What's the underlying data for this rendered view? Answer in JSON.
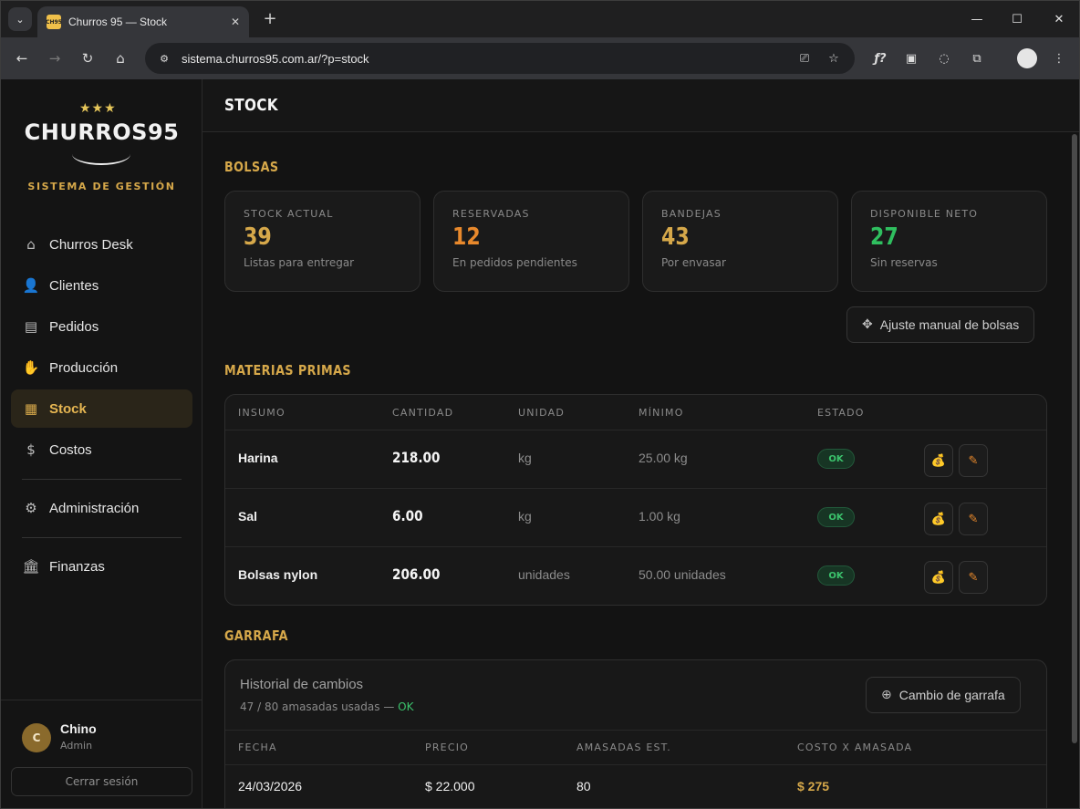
{
  "browser": {
    "tab_title": "Churros 95 — Stock",
    "tab_favicon_text": "CH95",
    "url": "sistema.churros95.com.ar/?p=stock"
  },
  "sidebar": {
    "logo_text": "CHURROS95",
    "logo_subtitle": "SISTEMA DE GESTIÓN",
    "items": [
      {
        "label": "Churros Desk",
        "icon": "home-icon"
      },
      {
        "label": "Clientes",
        "icon": "user-check-icon"
      },
      {
        "label": "Pedidos",
        "icon": "bag-icon"
      },
      {
        "label": "Producción",
        "icon": "hand-icon"
      },
      {
        "label": "Stock",
        "icon": "clipboard-icon",
        "active": true
      },
      {
        "label": "Costos",
        "icon": "dollar-circle-icon"
      },
      {
        "label": "Administración",
        "icon": "gear-icon"
      },
      {
        "label": "Finanzas",
        "icon": "bank-icon"
      }
    ],
    "user": {
      "initial": "C",
      "name": "Chino",
      "role": "Admin"
    },
    "logout_label": "Cerrar sesión"
  },
  "page": {
    "title": "STOCK",
    "bolsas": {
      "title": "BOLSAS",
      "cards": [
        {
          "label": "STOCK ACTUAL",
          "value": "39",
          "sub": "Listas para entregar",
          "color": "#d6a84a"
        },
        {
          "label": "RESERVADAS",
          "value": "12",
          "sub": "En pedidos pendientes",
          "color": "#e8892c"
        },
        {
          "label": "BANDEJAS",
          "value": "43",
          "sub": "Por envasar",
          "color": "#d6a84a"
        },
        {
          "label": "DISPONIBLE NETO",
          "value": "27",
          "sub": "Sin reservas",
          "color": "#2fbf5f"
        }
      ],
      "adjust_button": "Ajuste manual de bolsas"
    },
    "materias": {
      "title": "MATERIAS PRIMAS",
      "columns": [
        "INSUMO",
        "CANTIDAD",
        "UNIDAD",
        "MÍNIMO",
        "ESTADO"
      ],
      "rows": [
        {
          "insumo": "Harina",
          "cantidad": "218.00",
          "unidad": "kg",
          "minimo": "25.00 kg",
          "estado": "OK"
        },
        {
          "insumo": "Sal",
          "cantidad": "6.00",
          "unidad": "kg",
          "minimo": "1.00 kg",
          "estado": "OK"
        },
        {
          "insumo": "Bolsas nylon",
          "cantidad": "206.00",
          "unidad": "unidades",
          "minimo": "50.00 unidades",
          "estado": "OK"
        }
      ]
    },
    "garrafa": {
      "title": "GARRAFA",
      "history_title": "Historial de cambios",
      "history_sub": "47 / 80 amasadas usadas — ",
      "history_status": "OK",
      "change_button": "Cambio de garrafa",
      "columns": [
        "FECHA",
        "PRECIO",
        "AMASADAS EST.",
        "COSTO X AMASADA"
      ],
      "rows": [
        {
          "fecha": "24/03/2026",
          "precio": "$ 22.000",
          "amasadas": "80",
          "costo": "$ 275"
        }
      ]
    }
  }
}
